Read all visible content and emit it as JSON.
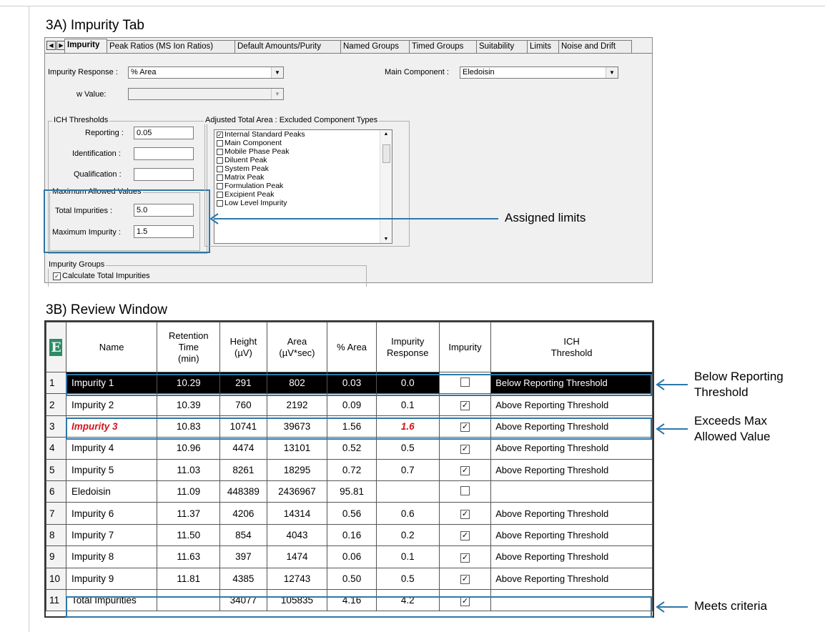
{
  "section_a_title": "3A) Impurity Tab",
  "section_b_title": "3B) Review Window",
  "impurity_tab": {
    "tabs": [
      "Impurity",
      "Peak Ratios (MS Ion Ratios)",
      "Default Amounts/Purity",
      "Named Groups",
      "Timed Groups",
      "Suitability",
      "Limits",
      "Noise and Drift"
    ],
    "impurity_response_label": "Impurity Response :",
    "impurity_response_value": "% Area",
    "w_value_label": "w Value:",
    "w_value_value": "",
    "main_component_label": "Main Component :",
    "main_component_value": "Eledoisin",
    "ich_thresholds_title": "ICH Thresholds",
    "reporting_label": "Reporting :",
    "reporting_value": "0.05",
    "identification_label": "Identification :",
    "identification_value": "",
    "qualification_label": "Qualification :",
    "qualification_value": "",
    "max_allowed_title": "Maximum Allowed Values",
    "total_impurities_label": "Total Impurities :",
    "total_impurities_value": "5.0",
    "maximum_impurity_label": "Maximum Impurity :",
    "maximum_impurity_value": "1.5",
    "adjusted_title": "Adjusted Total Area : Excluded Component Types",
    "component_types": [
      {
        "label": "Internal Standard Peaks",
        "checked": true
      },
      {
        "label": "Main Component",
        "checked": false
      },
      {
        "label": "Mobile Phase Peak",
        "checked": false
      },
      {
        "label": "Diluent Peak",
        "checked": false
      },
      {
        "label": "System Peak",
        "checked": false
      },
      {
        "label": "Matrix Peak",
        "checked": false
      },
      {
        "label": "Formulation Peak",
        "checked": false
      },
      {
        "label": "Excipient Peak",
        "checked": false
      },
      {
        "label": "Low Level Impurity",
        "checked": false
      }
    ],
    "impurity_groups_title": "Impurity Groups",
    "calculate_total_label": "Calculate Total Impurities",
    "calculate_total_checked": true,
    "callout_assigned": "Assigned limits"
  },
  "review": {
    "e_icon": "E",
    "columns": [
      "Name",
      "Retention\nTime\n(min)",
      "Height\n(µV)",
      "Area\n(µV*sec)",
      "% Area",
      "Impurity\nResponse",
      "Impurity",
      "ICH\nThreshold"
    ],
    "rows": [
      {
        "n": "1",
        "name": "Impurity 1",
        "rt": "10.29",
        "height": "291",
        "area": "802",
        "pct": "0.03",
        "resp": "0.0",
        "impurity": false,
        "ich": "Below Reporting Threshold"
      },
      {
        "n": "2",
        "name": "Impurity 2",
        "rt": "10.39",
        "height": "760",
        "area": "2192",
        "pct": "0.09",
        "resp": "0.1",
        "impurity": true,
        "ich": "Above Reporting Threshold"
      },
      {
        "n": "3",
        "name": "Impurity 3",
        "rt": "10.83",
        "height": "10741",
        "area": "39673",
        "pct": "1.56",
        "resp": "1.6",
        "impurity": true,
        "ich": "Above Reporting Threshold"
      },
      {
        "n": "4",
        "name": "Impurity 4",
        "rt": "10.96",
        "height": "4474",
        "area": "13101",
        "pct": "0.52",
        "resp": "0.5",
        "impurity": true,
        "ich": "Above Reporting Threshold"
      },
      {
        "n": "5",
        "name": "Impurity 5",
        "rt": "11.03",
        "height": "8261",
        "area": "18295",
        "pct": "0.72",
        "resp": "0.7",
        "impurity": true,
        "ich": "Above Reporting Threshold"
      },
      {
        "n": "6",
        "name": "Eledoisin",
        "rt": "11.09",
        "height": "448389",
        "area": "2436967",
        "pct": "95.81",
        "resp": "",
        "impurity": false,
        "ich": ""
      },
      {
        "n": "7",
        "name": "Impurity 6",
        "rt": "11.37",
        "height": "4206",
        "area": "14314",
        "pct": "0.56",
        "resp": "0.6",
        "impurity": true,
        "ich": "Above Reporting Threshold"
      },
      {
        "n": "8",
        "name": "Impurity 7",
        "rt": "11.50",
        "height": "854",
        "area": "4043",
        "pct": "0.16",
        "resp": "0.2",
        "impurity": true,
        "ich": "Above Reporting Threshold"
      },
      {
        "n": "9",
        "name": "Impurity 8",
        "rt": "11.63",
        "height": "397",
        "area": "1474",
        "pct": "0.06",
        "resp": "0.1",
        "impurity": true,
        "ich": "Above Reporting Threshold"
      },
      {
        "n": "10",
        "name": "Impurity 9",
        "rt": "11.81",
        "height": "4385",
        "area": "12743",
        "pct": "0.50",
        "resp": "0.5",
        "impurity": true,
        "ich": "Above Reporting Threshold"
      },
      {
        "n": "11",
        "name": "Total Impurities",
        "rt": "",
        "height": "34077",
        "area": "105835",
        "pct": "4.16",
        "resp": "4.2",
        "impurity": true,
        "ich": ""
      }
    ],
    "callout_below": "Below Reporting\nThreshold",
    "callout_exceeds": "Exceeds Max\nAllowed Value",
    "callout_meets": "Meets criteria"
  },
  "colors": {
    "callout": "#2e77a8",
    "exceeds_text": "#d0161b",
    "selected_row": "#000000"
  }
}
